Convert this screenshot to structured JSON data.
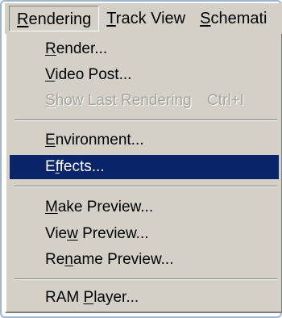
{
  "menubar": {
    "items": [
      {
        "label": "Rendering"
      },
      {
        "label": "Track View"
      },
      {
        "label": "Schemati"
      }
    ]
  },
  "menu": {
    "items": [
      {
        "label": "Render...",
        "enabled": true
      },
      {
        "label": "Video Post...",
        "enabled": true
      },
      {
        "label": "Show Last Rendering",
        "shortcut": "Ctrl+I",
        "enabled": false
      },
      {
        "label": "Environment...",
        "enabled": true
      },
      {
        "label": "Effects...",
        "enabled": true,
        "highlighted": true
      },
      {
        "label": "Make Preview...",
        "enabled": true
      },
      {
        "label": "View Preview...",
        "enabled": true
      },
      {
        "label": "Rename Preview...",
        "enabled": true
      },
      {
        "label": "RAM Player...",
        "enabled": true
      }
    ]
  },
  "colors": {
    "menu_bg": "#d4d0c8",
    "highlight_bg": "#0a246a",
    "highlight_text": "#ffffff",
    "disabled_text": "#a8a49c",
    "frame_border": "#9eb6cf"
  }
}
